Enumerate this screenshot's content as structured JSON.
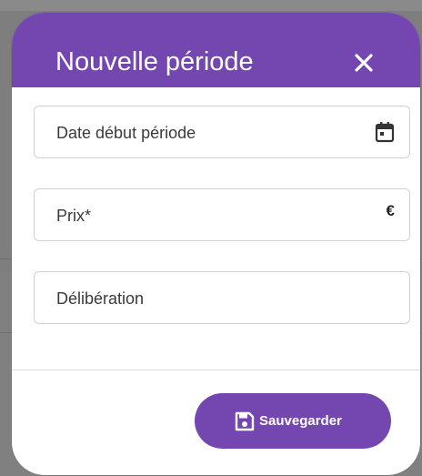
{
  "backdrop": {
    "partial_char": "I"
  },
  "dialog": {
    "title": "Nouvelle période",
    "close_icon": "close-icon",
    "fields": [
      {
        "label": "Date début période",
        "icon": "calendar-icon",
        "suffix": ""
      },
      {
        "label": "Prix*",
        "icon": "",
        "suffix": "€"
      },
      {
        "label": "Délibération",
        "icon": "",
        "suffix": ""
      }
    ],
    "save_button": {
      "label": "Sauvegarder",
      "icon": "save-icon"
    }
  },
  "colors": {
    "primary": "#7446b0",
    "header_text": "#ffffff",
    "field_border": "#d2d2d2",
    "backdrop": "#7d7d7d"
  }
}
